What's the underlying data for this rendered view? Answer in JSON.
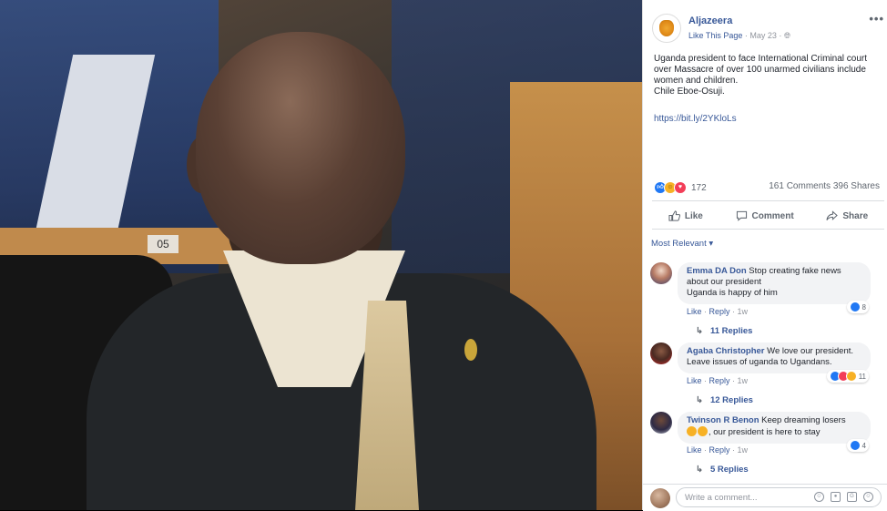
{
  "photo": {
    "desk_label": "05"
  },
  "post": {
    "page_name": "Aljazeera",
    "like_page": "Like This Page",
    "date": "May 23",
    "menu": "•••",
    "text_lines": [
      "Uganda president to face International Criminal court over Massacre of over 100 unarmed civilians include women and children.",
      "Chile Eboe-Osuji."
    ],
    "link": "https://bit.ly/2YKloLs",
    "reaction_count": "172",
    "comments_count": "161 Comments",
    "shares_count": "396 Shares"
  },
  "actions": {
    "like": "Like",
    "comment": "Comment",
    "share": "Share"
  },
  "filter": "Most Relevant",
  "comments": [
    {
      "name": "Emma DA Don",
      "text_first": "Stop creating fake news about our president",
      "text_second": "Uganda is happy of him",
      "like": "Like",
      "reply": "Reply",
      "time": "1w",
      "reactions": "8",
      "replies": "11 Replies"
    },
    {
      "name": "Agaba Christopher",
      "text_first": "We love our president. Leave issues of uganda to Ugandans.",
      "text_second": "",
      "like": "Like",
      "reply": "Reply",
      "time": "1w",
      "reactions": "11",
      "replies": "12 Replies"
    },
    {
      "name": "Twinson R Benon",
      "text_first": "Keep dreaming losers",
      "text_second": ", our president is here to stay",
      "like": "Like",
      "reply": "Reply",
      "time": "1w",
      "reactions": "4",
      "replies": "5 Replies"
    }
  ],
  "composer": {
    "placeholder": "Write a comment..."
  },
  "colors": {
    "link": "#385898",
    "like": "#2078f4",
    "love": "#f33e58",
    "haha": "#f7b125"
  }
}
